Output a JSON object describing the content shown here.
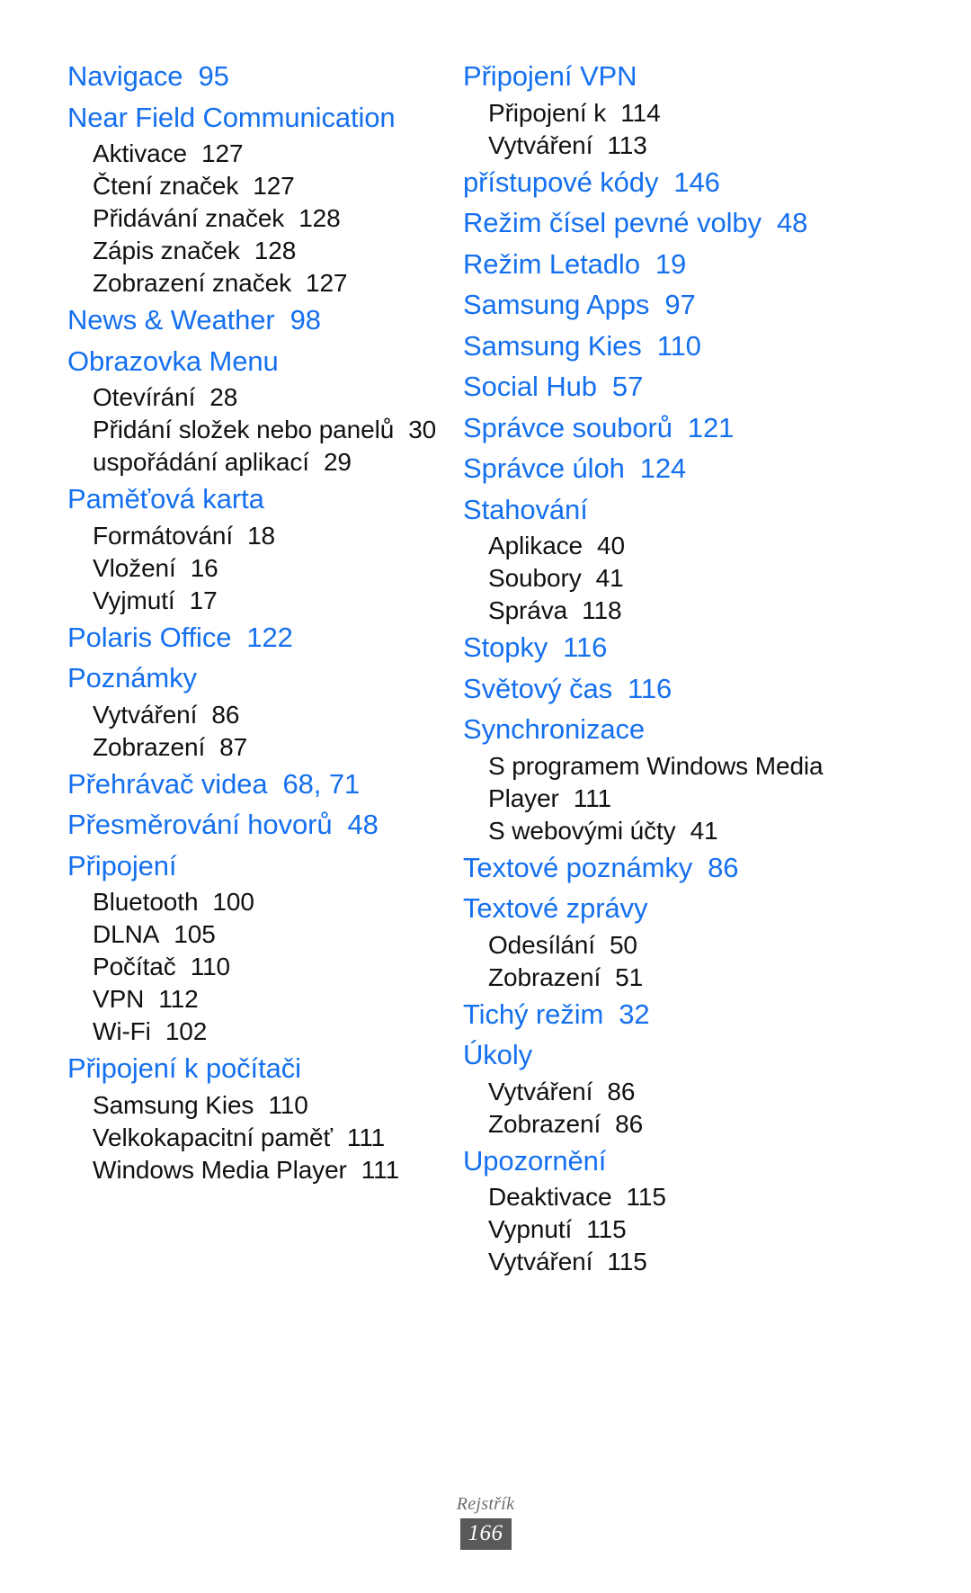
{
  "document": {
    "type": "index",
    "language": "cs",
    "accent_color": "#1570ef",
    "body_color": "#111111"
  },
  "footer": {
    "label": "Rejstřík",
    "page_number": "166",
    "page_box_color": "#595959"
  },
  "columns": [
    {
      "id": "left",
      "entries": [
        {
          "title": "Navigace",
          "page": "95",
          "subs": []
        },
        {
          "title": "Near Field Communication",
          "page": "",
          "subs": [
            {
              "text": "Aktivace",
              "page": "127"
            },
            {
              "text": "Čtení značek",
              "page": "127"
            },
            {
              "text": "Přidávání značek",
              "page": "128"
            },
            {
              "text": "Zápis značek",
              "page": "128"
            },
            {
              "text": "Zobrazení značek",
              "page": "127"
            }
          ]
        },
        {
          "title": "News & Weather",
          "page": "98",
          "subs": []
        },
        {
          "title": "Obrazovka Menu",
          "page": "",
          "subs": [
            {
              "text": "Otevírání",
              "page": "28"
            },
            {
              "text": "Přidání složek nebo panelů",
              "page": "30",
              "wrap": true
            },
            {
              "text": "uspořádání aplikací",
              "page": "29"
            }
          ]
        },
        {
          "title": "Paměťová karta",
          "page": "",
          "subs": [
            {
              "text": "Formátování",
              "page": "18"
            },
            {
              "text": "Vložení",
              "page": "16"
            },
            {
              "text": "Vyjmutí",
              "page": "17"
            }
          ]
        },
        {
          "title": "Polaris Office",
          "page": "122",
          "subs": []
        },
        {
          "title": "Poznámky",
          "page": "",
          "subs": [
            {
              "text": "Vytváření",
              "page": "86"
            },
            {
              "text": "Zobrazení",
              "page": "87"
            }
          ]
        },
        {
          "title": "Přehrávač videa",
          "page": "68, 71",
          "subs": []
        },
        {
          "title": "Přesměrování hovorů",
          "page": "48",
          "subs": []
        },
        {
          "title": "Připojení",
          "page": "",
          "subs": [
            {
              "text": "Bluetooth",
              "page": "100"
            },
            {
              "text": "DLNA",
              "page": "105"
            },
            {
              "text": "Počítač",
              "page": "110"
            },
            {
              "text": "VPN",
              "page": "112"
            },
            {
              "text": "Wi-Fi",
              "page": "102"
            }
          ]
        },
        {
          "title": "Připojení k počítači",
          "page": "",
          "subs": [
            {
              "text": "Samsung Kies",
              "page": "110"
            },
            {
              "text": "Velkokapacitní paměť",
              "page": "111"
            },
            {
              "text": "Windows Media Player",
              "page": "111"
            }
          ]
        }
      ]
    },
    {
      "id": "right",
      "entries": [
        {
          "title": "Připojení VPN",
          "page": "",
          "subs": [
            {
              "text": "Připojení k",
              "page": "114"
            },
            {
              "text": "Vytváření",
              "page": "113"
            }
          ]
        },
        {
          "title": "přístupové kódy",
          "page": "146",
          "subs": []
        },
        {
          "title": "Režim čísel pevné volby",
          "page": "48",
          "subs": []
        },
        {
          "title": "Režim Letadlo",
          "page": "19",
          "subs": []
        },
        {
          "title": "Samsung Apps",
          "page": "97",
          "subs": []
        },
        {
          "title": "Samsung Kies",
          "page": "110",
          "subs": []
        },
        {
          "title": "Social Hub",
          "page": "57",
          "subs": []
        },
        {
          "title": "Správce souborů",
          "page": "121",
          "subs": []
        },
        {
          "title": "Správce úloh",
          "page": "124",
          "subs": []
        },
        {
          "title": "Stahování",
          "page": "",
          "subs": [
            {
              "text": "Aplikace",
              "page": "40"
            },
            {
              "text": "Soubory",
              "page": "41"
            },
            {
              "text": "Správa",
              "page": "118"
            }
          ]
        },
        {
          "title": "Stopky",
          "page": "116",
          "subs": []
        },
        {
          "title": "Světový čas",
          "page": "116",
          "subs": []
        },
        {
          "title": "Synchronizace",
          "page": "",
          "subs": [
            {
              "text": "S programem Windows Media Player",
              "page": "111",
              "wrap": true
            },
            {
              "text": "S webovými účty",
              "page": "41"
            }
          ]
        },
        {
          "title": "Textové poznámky",
          "page": "86",
          "subs": []
        },
        {
          "title": "Textové zprávy",
          "page": "",
          "subs": [
            {
              "text": "Odesílání",
              "page": "50"
            },
            {
              "text": "Zobrazení",
              "page": "51"
            }
          ]
        },
        {
          "title": "Tichý režim",
          "page": "32",
          "subs": []
        },
        {
          "title": "Úkoly",
          "page": "",
          "subs": [
            {
              "text": "Vytváření",
              "page": "86"
            },
            {
              "text": "Zobrazení",
              "page": "86"
            }
          ]
        },
        {
          "title": "Upozornění",
          "page": "",
          "subs": [
            {
              "text": "Deaktivace",
              "page": "115"
            },
            {
              "text": "Vypnutí",
              "page": "115"
            },
            {
              "text": "Vytváření",
              "page": "115"
            }
          ]
        }
      ]
    }
  ]
}
